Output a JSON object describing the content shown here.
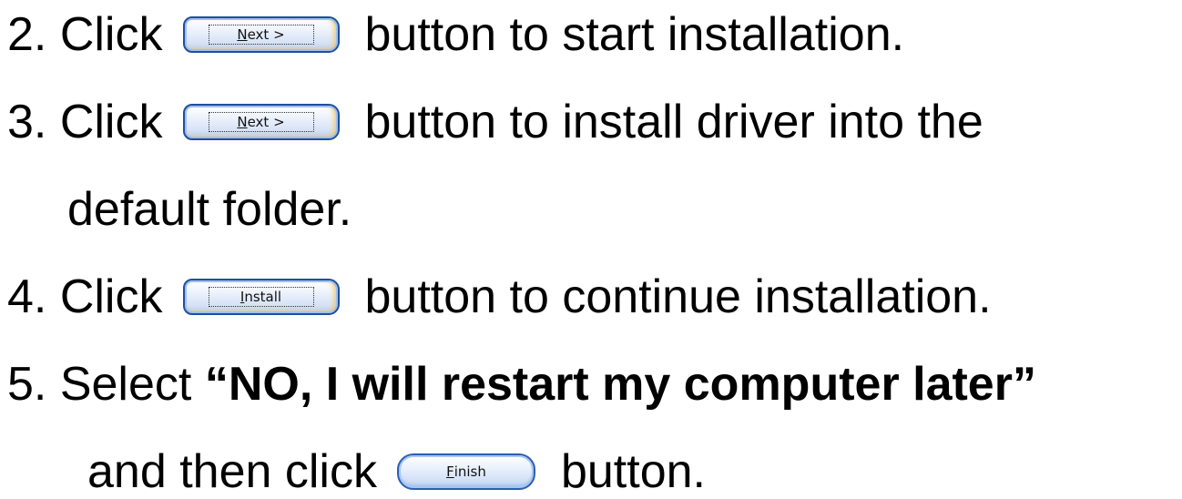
{
  "steps": [
    {
      "number": "2.",
      "verb": "Click",
      "button": {
        "label": "Next >",
        "mnemonic": "N",
        "rest": "ext >"
      },
      "after": "button to start installation."
    },
    {
      "number": "3.",
      "verb": "Click",
      "button": {
        "label": "Next >",
        "mnemonic": "N",
        "rest": "ext >"
      },
      "after": "button to install driver into the",
      "continuation": "default folder."
    },
    {
      "number": "4.",
      "verb": "Click",
      "button": {
        "label": "Install",
        "mnemonic": "I",
        "rest": "nstall"
      },
      "after": "button to continue installation."
    },
    {
      "number": "5.",
      "verb": "Select",
      "emphasis": "“NO, I will restart my computer later”",
      "continuation_prefix": "and then click",
      "button": {
        "label": "Finish",
        "mnemonic": "F",
        "rest": "inish"
      },
      "after": "button."
    }
  ],
  "colors": {
    "text": "#000000",
    "background": "#ffffff",
    "button_border": "#1f4f9e",
    "button_accent": "#f2c86e"
  }
}
